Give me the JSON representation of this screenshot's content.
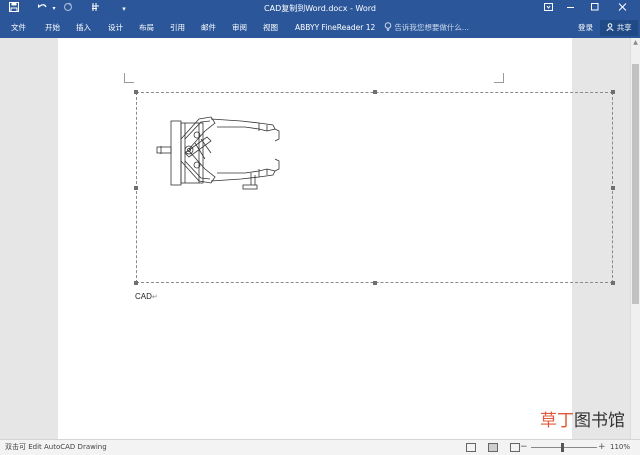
{
  "window": {
    "title": "CAD复制到Word.docx - Word",
    "controls": [
      "restore-icon",
      "minimize-icon",
      "maximize-icon",
      "close-icon"
    ]
  },
  "quick_access": {
    "icons": [
      "save-icon",
      "undo-icon",
      "redo-icon",
      "touch-mode-icon",
      "customize-icon"
    ]
  },
  "ribbon": {
    "tabs": [
      "文件",
      "开始",
      "插入",
      "设计",
      "布局",
      "引用",
      "邮件",
      "审阅",
      "视图",
      "ABBYY FineReader 12"
    ],
    "tell_me": "告诉我您想要做什么...",
    "login": "登录",
    "share": "共享"
  },
  "document": {
    "embedded_object": "AutoCAD Drawing",
    "caption": "CAD",
    "paragraph_mark": "↵"
  },
  "status_bar": {
    "text": "双击可 Edit AutoCAD Drawing",
    "views": [
      "read-mode-icon",
      "print-layout-icon",
      "web-layout-icon"
    ],
    "zoom_minus": "−",
    "zoom_plus": "+",
    "zoom": "110%"
  },
  "watermark": {
    "accent": "草丁",
    "rest": "图书馆"
  },
  "colors": {
    "ribbon": "#2b579a",
    "page": "#ffffff",
    "workspace": "#e6e6e6",
    "watermark_accent": "#e0593a"
  }
}
